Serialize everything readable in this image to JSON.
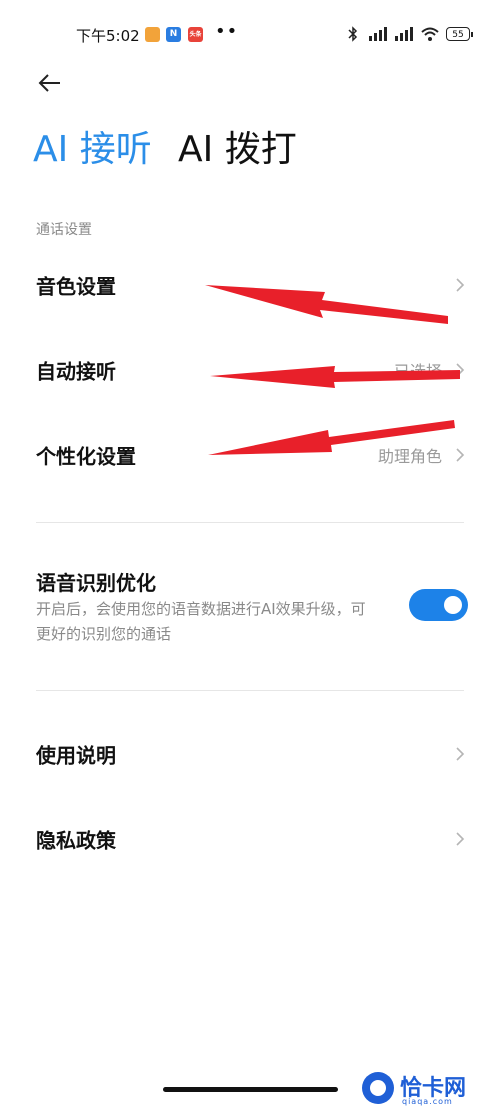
{
  "status_bar": {
    "time": "下午5:02",
    "app_badges": [
      "",
      "N",
      "头条"
    ],
    "more_dots": "••",
    "battery": "55"
  },
  "tabs": [
    {
      "label": "AI 接听",
      "active": true
    },
    {
      "label": "AI 拨打",
      "active": false
    }
  ],
  "section_label": "通话设置",
  "settings": [
    {
      "label": "音色设置",
      "value": ""
    },
    {
      "label": "自动接听",
      "value": "已选择"
    },
    {
      "label": "个性化设置",
      "value": "助理角色"
    }
  ],
  "voice_optimization": {
    "title": "语音识别优化",
    "description": "开启后，会使用您的语音数据进行AI效果升级，可更好的识别您的通话",
    "enabled": true
  },
  "links": [
    {
      "label": "使用说明"
    },
    {
      "label": "隐私政策"
    }
  ],
  "watermark": {
    "name": "恰卡网",
    "url": "qiaqa.com"
  },
  "colors": {
    "accent": "#2b8ee8",
    "toggle": "#1d82e8",
    "annotation_arrow": "#e8202a"
  }
}
